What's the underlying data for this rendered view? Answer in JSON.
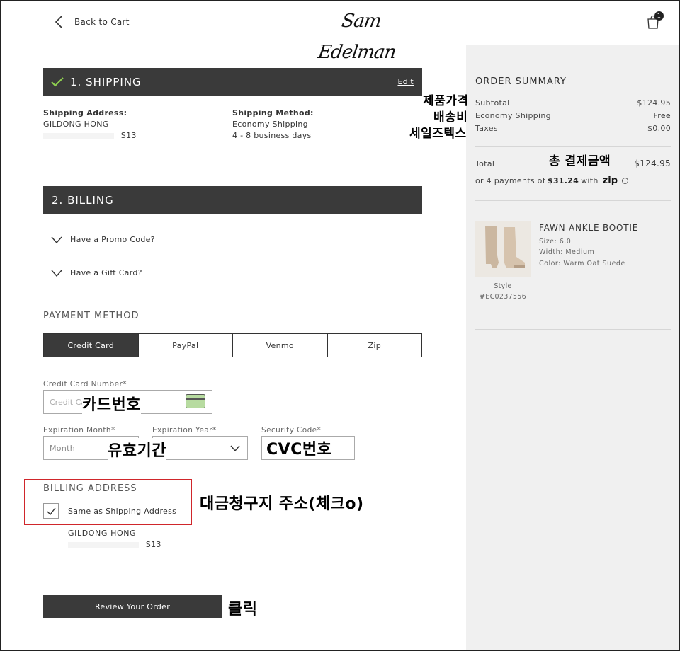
{
  "header": {
    "back_label": "Back to Cart",
    "logo_text": "Sam Edelman",
    "cart_count": "1"
  },
  "shipping": {
    "title": "1. SHIPPING",
    "edit_label": "Edit",
    "address_label": "Shipping Address:",
    "name": "GILDONG HONG",
    "address_suffix": "S13",
    "method_label": "Shipping Method:",
    "method": "Economy Shipping",
    "delivery": "4 - 8 business days"
  },
  "billing": {
    "title": "2. BILLING",
    "promo_label": "Have a Promo Code?",
    "gift_label": "Have a Gift Card?"
  },
  "payment": {
    "title": "PAYMENT METHOD",
    "tabs": [
      "Credit Card",
      "PayPal",
      "Venmo",
      "Zip"
    ],
    "card_number_label": "Credit Card Number*",
    "card_number_placeholder": "Credit Card Number",
    "exp_month_label": "Expiration Month*",
    "exp_month_placeholder": "Month",
    "exp_year_label": "Expiration Year*",
    "security_label": "Security Code*"
  },
  "billing_address": {
    "title": "BILLING ADDRESS",
    "same_label": "Same as Shipping Address",
    "name": "GILDONG HONG",
    "address_suffix": "S13"
  },
  "review_button": "Review Your Order",
  "summary": {
    "title": "ORDER SUMMARY",
    "subtotal_label": "Subtotal",
    "subtotal": "$124.95",
    "shipping_label": "Economy Shipping",
    "shipping": "Free",
    "taxes_label": "Taxes",
    "taxes": "$0.00",
    "total_label": "Total",
    "total": "$124.95",
    "zip_prefix": "or 4 payments of",
    "zip_amount": "$31.24",
    "zip_suffix": "with",
    "zip_logo": "zip"
  },
  "product": {
    "name": "FAWN ANKLE BOOTIE",
    "size": "Size: 6.0",
    "width": "Width: Medium",
    "color": "Color: Warm Oat Suede",
    "style_label": "Style",
    "style_code": "#EC0237556"
  },
  "annotations": {
    "price_lines": [
      "제품가격",
      "배송비",
      "세일즈텍스"
    ],
    "total": "총 결제금액",
    "card": "카드번호",
    "expiry": "유효기간",
    "cvc": "CVC번호",
    "billing": "대금청구지 주소(체크o)",
    "click": "클릭"
  },
  "colors": {
    "dark": "#3a3a3a",
    "sidebar": "#f0f0f0",
    "highlight": "#d0262b",
    "check": "#8fd14f"
  }
}
